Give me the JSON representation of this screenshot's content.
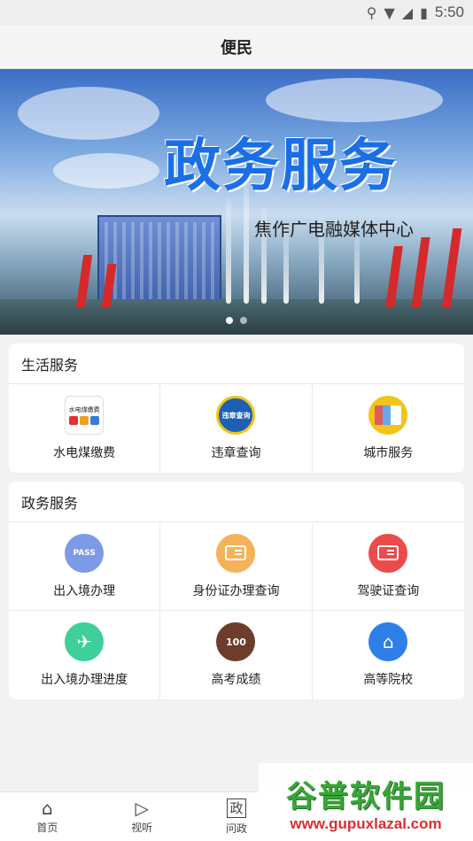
{
  "status_bar": {
    "time": "5:50"
  },
  "header": {
    "title": "便民"
  },
  "banner": {
    "headline": "政务服务",
    "subline": "焦作广电融媒体中心"
  },
  "life_services": {
    "title": "生活服务",
    "items": [
      {
        "label": "水电煤缴费",
        "icon_text": "水电煤缴费"
      },
      {
        "label": "违章查询",
        "icon_text": "违章查询"
      },
      {
        "label": "城市服务"
      }
    ]
  },
  "gov_services": {
    "title": "政务服务",
    "items": [
      {
        "label": "出入境办理",
        "icon_text": "PASS"
      },
      {
        "label": "身份证办理查询"
      },
      {
        "label": "驾驶证查询"
      },
      {
        "label": "出入境办理进度"
      },
      {
        "label": "高考成绩",
        "icon_text": "100"
      },
      {
        "label": "高等院校"
      }
    ]
  },
  "bottom_nav": {
    "items": [
      {
        "label": "首页"
      },
      {
        "label": "视听"
      },
      {
        "label": "问政",
        "icon_text": "政"
      }
    ]
  },
  "watermark": {
    "main": "谷普软件园",
    "url": "www.gupuxlazal.com"
  }
}
